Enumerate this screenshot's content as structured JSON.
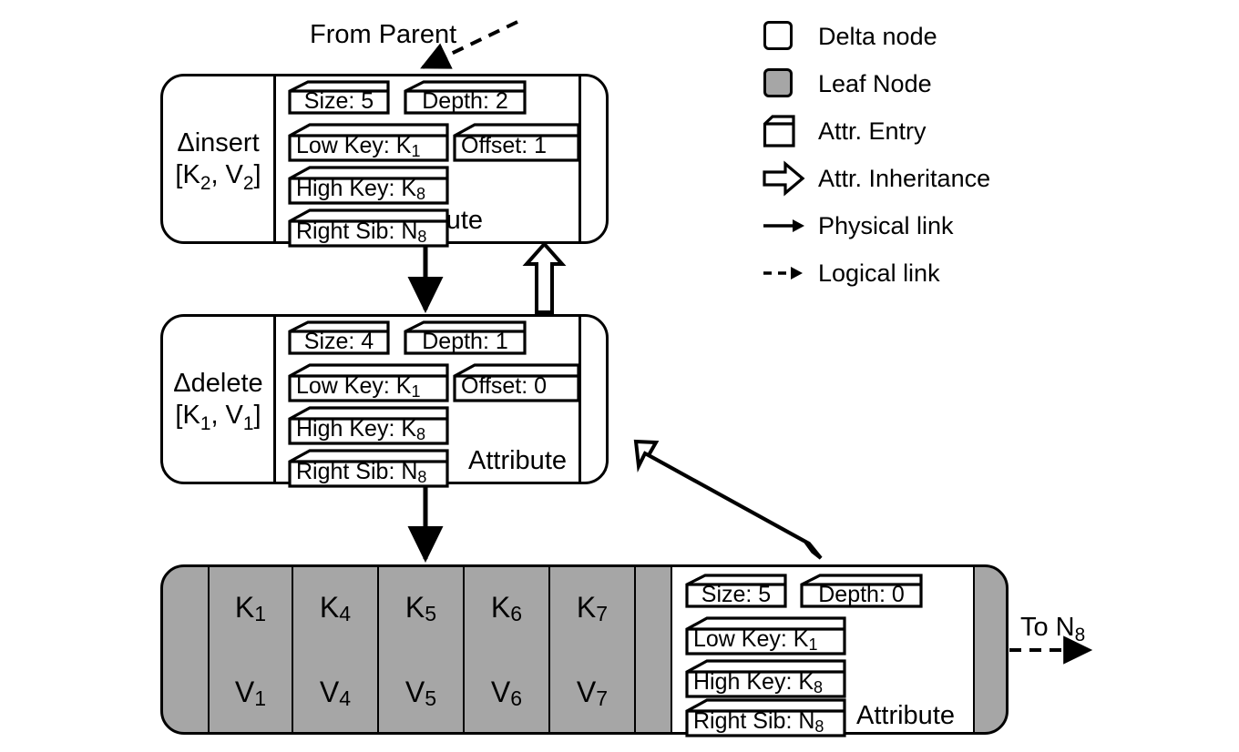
{
  "figure": {
    "labels": {
      "from_parent": "From Parent",
      "to_sibling": "To N₈",
      "attribute_word": "Attribute"
    }
  },
  "nodes": [
    {
      "id": "delta-insert",
      "kind": "delta",
      "title_line1": "Δinsert",
      "title_line2": "[K₂, V₂]",
      "attribute_word": "Attribute",
      "entries": [
        {
          "name": "size",
          "label": "Size: 5"
        },
        {
          "name": "depth",
          "label": "Depth: 2"
        },
        {
          "name": "low-key",
          "label": "Low Key: K₁"
        },
        {
          "name": "offset",
          "label": "Offset: 1"
        },
        {
          "name": "high-key",
          "label": "High Key: K₈"
        },
        {
          "name": "right-sib",
          "label": "Right Sib: N₈"
        }
      ]
    },
    {
      "id": "delta-delete",
      "kind": "delta",
      "title_line1": "Δdelete",
      "title_line2": "[K₁, V₁]",
      "attribute_word": "Attribute",
      "entries": [
        {
          "name": "size",
          "label": "Size: 4"
        },
        {
          "name": "depth",
          "label": "Depth: 1"
        },
        {
          "name": "low-key",
          "label": "Low Key: K₁"
        },
        {
          "name": "offset",
          "label": "Offset: 0"
        },
        {
          "name": "high-key",
          "label": "High Key: K₈"
        },
        {
          "name": "right-sib",
          "label": "Right Sib: N₈"
        }
      ]
    },
    {
      "id": "leaf-node",
      "kind": "leaf",
      "attribute_word": "Attribute",
      "keys": [
        "K₁",
        "K₄",
        "K₅",
        "K₆",
        "K₇"
      ],
      "values": [
        "V₁",
        "V₄",
        "V₅",
        "V₆",
        "V₇"
      ],
      "entries": [
        {
          "name": "size",
          "label": "Size: 5"
        },
        {
          "name": "depth",
          "label": "Depth: 0"
        },
        {
          "name": "low-key",
          "label": "Low Key: K₁"
        },
        {
          "name": "high-key",
          "label": "High Key: K₈"
        },
        {
          "name": "right-sib",
          "label": "Right Sib: N₈"
        }
      ]
    }
  ],
  "legend": {
    "items": [
      {
        "icon": "white-rounded-square-icon",
        "label": "Delta node"
      },
      {
        "icon": "gray-rounded-square-icon",
        "label": "Leaf Node"
      },
      {
        "icon": "attr-entry-square-icon",
        "label": "Attr. Entry"
      },
      {
        "icon": "hollow-arrow-icon",
        "label": "Attr. Inheritance"
      },
      {
        "icon": "solid-arrow-icon",
        "label": "Physical link"
      },
      {
        "icon": "dashed-arrow-icon",
        "label": "Logical link"
      }
    ]
  },
  "colors": {
    "leaf_fill": "#A6A6A6",
    "delta_fill": "#FFFFFF",
    "stroke": "#000000"
  }
}
